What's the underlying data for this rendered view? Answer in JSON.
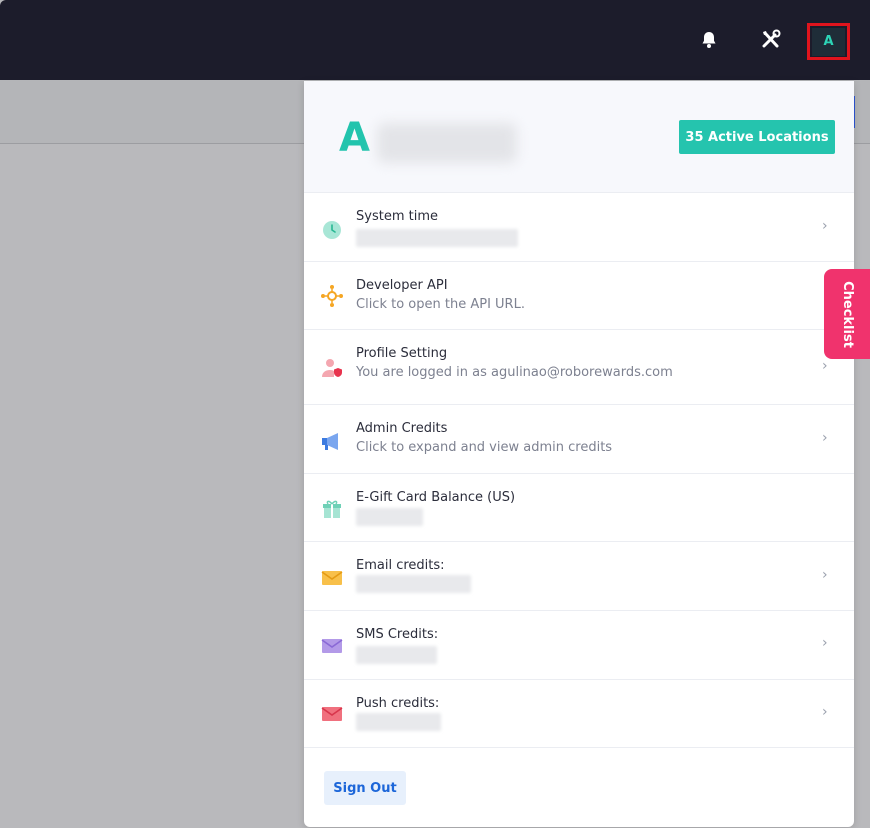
{
  "header": {
    "avatar_initial": "A",
    "icons": [
      "bell-icon",
      "tools-icon"
    ]
  },
  "panel": {
    "initial": "A",
    "active_locations_label": "35 Active Locations",
    "rows": [
      {
        "title": "System time",
        "subtitle": "",
        "icon": "clock-icon",
        "has_chevron": true
      },
      {
        "title": "Developer API",
        "subtitle": "Click to open the API URL.",
        "icon": "api-icon",
        "has_chevron": false
      },
      {
        "title": "Profile Setting",
        "subtitle": "You are logged in as agulinao@roborewards.com",
        "icon": "user-shield-icon",
        "has_chevron": true
      },
      {
        "title": "Admin Credits",
        "subtitle": "Click to expand and view admin credits",
        "icon": "megaphone-icon",
        "has_chevron": true
      },
      {
        "title": "E-Gift Card Balance (US)",
        "subtitle": "",
        "icon": "gift-icon",
        "has_chevron": false
      },
      {
        "title": "Email credits:",
        "subtitle": "",
        "icon": "envelope-yellow-icon",
        "has_chevron": true
      },
      {
        "title": "SMS Credits:",
        "subtitle": "",
        "icon": "envelope-purple-icon",
        "has_chevron": true
      },
      {
        "title": "Push credits:",
        "subtitle": "",
        "icon": "envelope-red-icon",
        "has_chevron": true
      }
    ],
    "chevron": "›",
    "sign_out_label": "Sign Out"
  },
  "checklist_label": "Checklist",
  "colors": {
    "topbar": "#1c1c2b",
    "accent_teal": "#25c4ae",
    "checklist_pink": "#f0336d",
    "highlight_red": "#e0141d",
    "sign_out_blue": "#1c66d9"
  }
}
